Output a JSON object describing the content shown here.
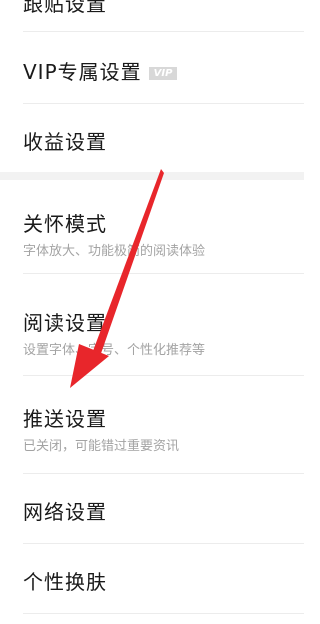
{
  "settings": {
    "items": [
      {
        "title": "跟贴设置"
      },
      {
        "title": "VIP专属设置",
        "badge": "VIP"
      },
      {
        "title": "收益设置"
      },
      {
        "title": "关怀模式",
        "subtitle": "字体放大、功能极简的阅读体验"
      },
      {
        "title": "阅读设置",
        "subtitle": "设置字体、字号、个性化推荐等"
      },
      {
        "title": "推送设置",
        "subtitle": "已关闭，可能错过重要资讯"
      },
      {
        "title": "网络设置"
      },
      {
        "title": "个性换肤"
      }
    ]
  },
  "annotation": {
    "arrow_color": "#e8262b"
  }
}
